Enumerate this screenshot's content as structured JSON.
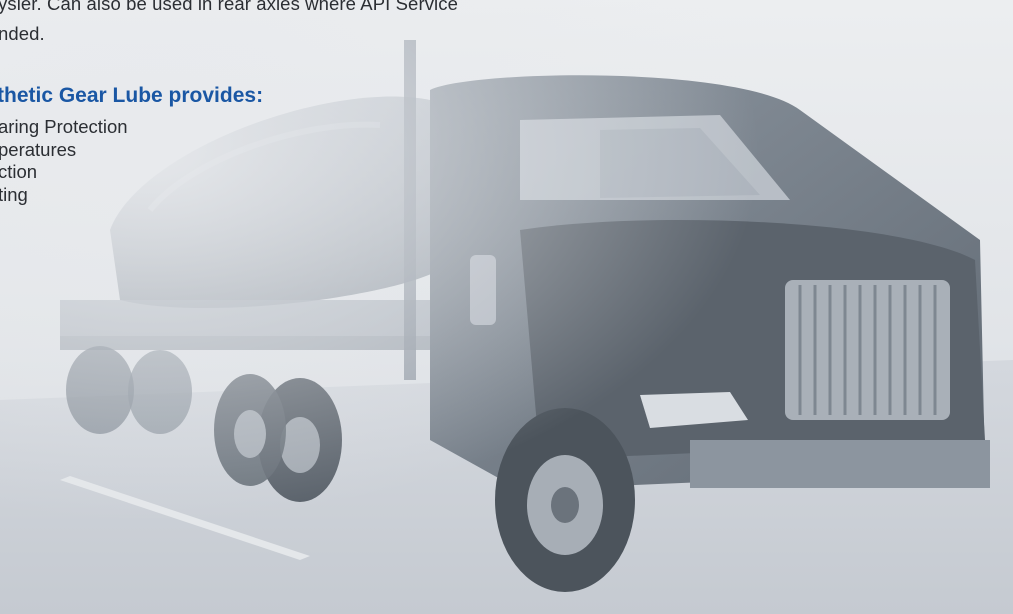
{
  "document": {
    "paragraph_lines": [
      "ysler. Can also be used in rear axles where API Service",
      "nded."
    ],
    "subheading": "thetic Gear Lube provides:",
    "benefits": [
      "aring Protection",
      "peratures",
      "ction",
      "ting"
    ]
  },
  "background": {
    "image": "truck-tanker-photo",
    "tone": "grayscale-blue",
    "colors": {
      "sky": "#e6e8eb",
      "road": "#cfd3d9",
      "truck_dark": "#6d7680",
      "truck_mid": "#9aa2ac",
      "accent_heading": "#1a57a4"
    }
  }
}
